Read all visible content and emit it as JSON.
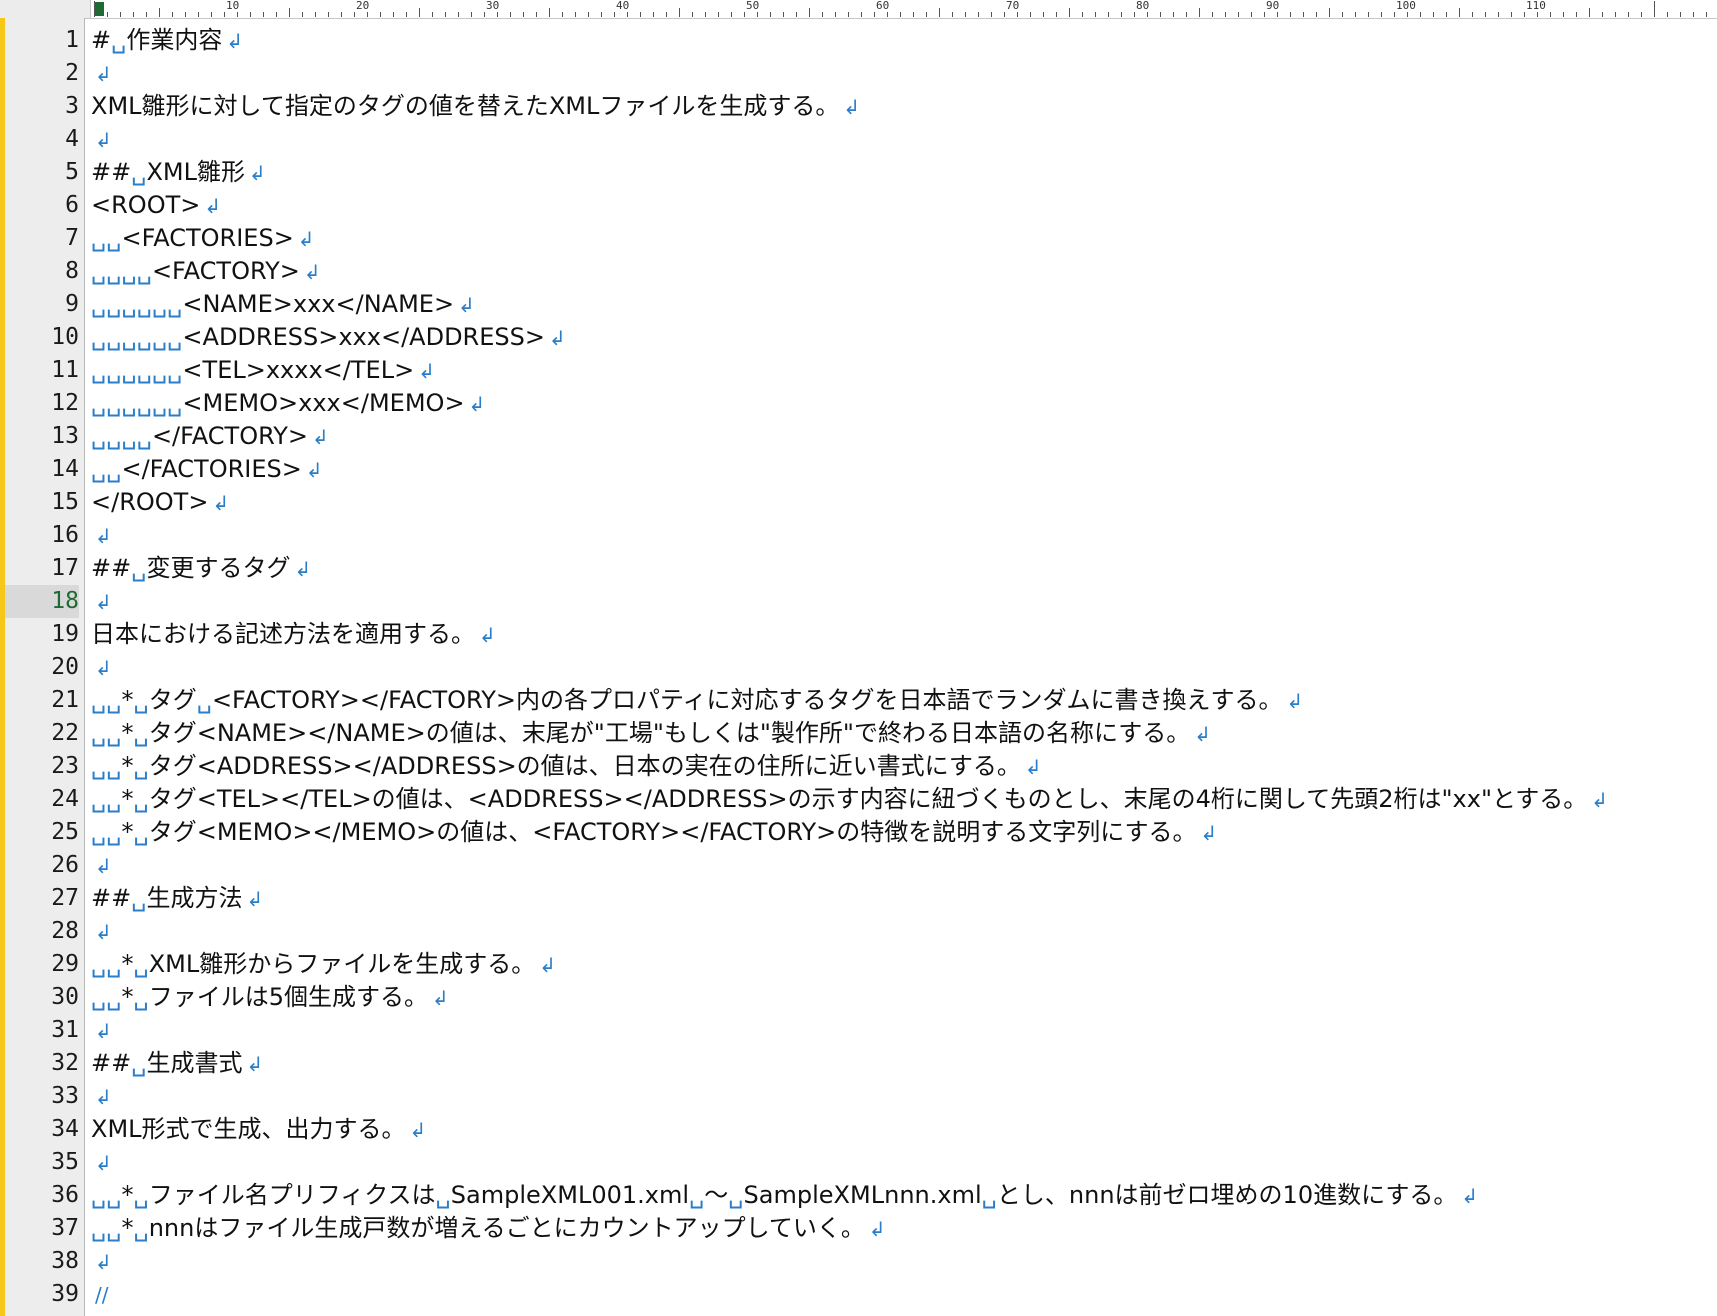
{
  "ruler": {
    "labels": [
      "10",
      "20",
      "30",
      "40",
      "50",
      "60",
      "70",
      "80",
      "90",
      "100",
      "110"
    ]
  },
  "symbols": {
    "space_mark": "␣",
    "eol_mark": "↲",
    "eof_mark": "//"
  },
  "colors": {
    "accent_bar": "#f6c619",
    "whitespace_marks": "#2a7ec9",
    "current_line_number": "#1f6b35"
  },
  "editor": {
    "current_line": 18,
    "lines": [
      {
        "n": "1",
        "text": "#␣作業内容"
      },
      {
        "n": "2",
        "text": ""
      },
      {
        "n": "3",
        "text": "XML雛形に対して指定のタグの値を替えたXMLファイルを生成する。"
      },
      {
        "n": "4",
        "text": ""
      },
      {
        "n": "5",
        "text": "##␣XML雛形"
      },
      {
        "n": "6",
        "text": "<ROOT>"
      },
      {
        "n": "7",
        "text": "␣␣<FACTORIES>"
      },
      {
        "n": "8",
        "text": "␣␣␣␣<FACTORY>"
      },
      {
        "n": "9",
        "text": "␣␣␣␣␣␣<NAME>xxx</NAME>"
      },
      {
        "n": "10",
        "text": "␣␣␣␣␣␣<ADDRESS>xxx</ADDRESS>"
      },
      {
        "n": "11",
        "text": "␣␣␣␣␣␣<TEL>xxxx</TEL>"
      },
      {
        "n": "12",
        "text": "␣␣␣␣␣␣<MEMO>xxx</MEMO>"
      },
      {
        "n": "13",
        "text": "␣␣␣␣</FACTORY>"
      },
      {
        "n": "14",
        "text": "␣␣</FACTORIES>"
      },
      {
        "n": "15",
        "text": "</ROOT>"
      },
      {
        "n": "16",
        "text": ""
      },
      {
        "n": "17",
        "text": "##␣変更するタグ"
      },
      {
        "n": "18",
        "text": ""
      },
      {
        "n": "19",
        "text": "日本における記述方法を適用する。"
      },
      {
        "n": "20",
        "text": ""
      },
      {
        "n": "21",
        "text": "␣␣*␣タグ␣<FACTORY></FACTORY>内の各プロパティに対応するタグを日本語でランダムに書き換えする。"
      },
      {
        "n": "22",
        "text": "␣␣*␣タグ<NAME></NAME>の値は、末尾が\"工場\"もしくは\"製作所\"で終わる日本語の名称にする。"
      },
      {
        "n": "23",
        "text": "␣␣*␣タグ<ADDRESS></ADDRESS>の値は、日本の実在の住所に近い書式にする。"
      },
      {
        "n": "24",
        "text": "␣␣*␣タグ<TEL></TEL>の値は、<ADDRESS></ADDRESS>の示す内容に紐づくものとし、末尾の4桁に関して先頭2桁は\"xx\"とする。"
      },
      {
        "n": "25",
        "text": "␣␣*␣タグ<MEMO></MEMO>の値は、<FACTORY></FACTORY>の特徴を説明する文字列にする。"
      },
      {
        "n": "26",
        "text": ""
      },
      {
        "n": "27",
        "text": "##␣生成方法"
      },
      {
        "n": "28",
        "text": ""
      },
      {
        "n": "29",
        "text": "␣␣*␣XML雛形からファイルを生成する。"
      },
      {
        "n": "30",
        "text": "␣␣*␣ファイルは5個生成する。"
      },
      {
        "n": "31",
        "text": ""
      },
      {
        "n": "32",
        "text": "##␣生成書式"
      },
      {
        "n": "33",
        "text": ""
      },
      {
        "n": "34",
        "text": "XML形式で生成、出力する。"
      },
      {
        "n": "35",
        "text": ""
      },
      {
        "n": "36",
        "text": "␣␣*␣ファイル名プリフィクスは␣SampleXML001.xml␣～␣SampleXMLnnn.xml␣とし、nnnは前ゼロ埋めの10進数にする。"
      },
      {
        "n": "37",
        "text": "␣␣*␣nnnはファイル生成戸数が増えるごとにカウントアップしていく。"
      },
      {
        "n": "38",
        "text": ""
      },
      {
        "n": "39",
        "text": "",
        "eof": true
      }
    ]
  }
}
